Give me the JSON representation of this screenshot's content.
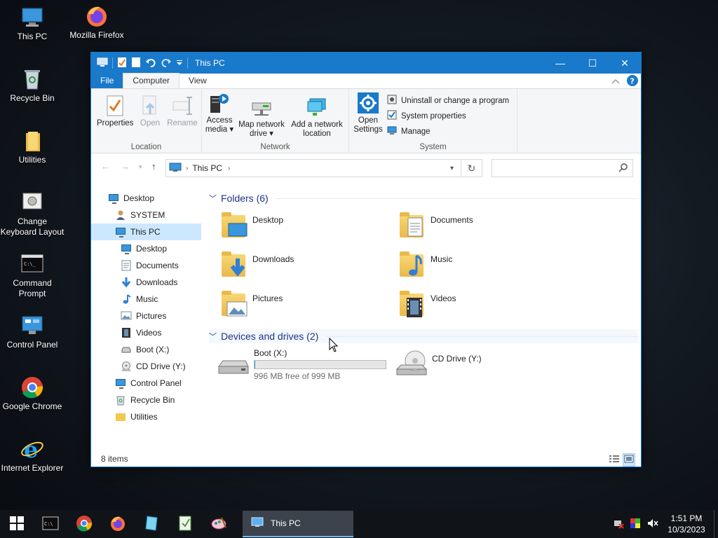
{
  "desktop": {
    "icons": [
      {
        "label": "This PC"
      },
      {
        "label": "Mozilla Firefox"
      },
      {
        "label": "Recycle Bin"
      },
      {
        "label": "Utilities"
      },
      {
        "label": "Change Keyboard Layout"
      },
      {
        "label": "Command Prompt"
      },
      {
        "label": "Control Panel"
      },
      {
        "label": "Google Chrome"
      },
      {
        "label": "Internet Explorer"
      }
    ]
  },
  "window": {
    "title": "This PC",
    "controls": {
      "minimize": "—",
      "maximize": "☐",
      "close": "✕"
    },
    "tabs": [
      "File",
      "Computer",
      "View"
    ],
    "ribbon": {
      "location": {
        "label": "Location",
        "properties": "Properties",
        "open": "Open",
        "rename": "Rename"
      },
      "network": {
        "label": "Network",
        "access_media": "Access media",
        "map_drive": "Map network drive",
        "add_location": "Add a network location"
      },
      "system": {
        "label": "System",
        "open_settings": "Open Settings",
        "uninstall": "Uninstall or change a program",
        "system_properties": "System properties",
        "manage": "Manage"
      }
    },
    "address": {
      "path": "This PC",
      "search_placeholder": ""
    },
    "nav": [
      {
        "label": "Desktop"
      },
      {
        "label": "SYSTEM"
      },
      {
        "label": "This PC"
      },
      {
        "label": "Desktop"
      },
      {
        "label": "Documents"
      },
      {
        "label": "Downloads"
      },
      {
        "label": "Music"
      },
      {
        "label": "Pictures"
      },
      {
        "label": "Videos"
      },
      {
        "label": "Boot (X:)"
      },
      {
        "label": "CD Drive (Y:)"
      },
      {
        "label": "Control Panel"
      },
      {
        "label": "Recycle Bin"
      },
      {
        "label": "Utilities"
      }
    ],
    "folders_header": "Folders (6)",
    "folders": [
      {
        "name": "Desktop"
      },
      {
        "name": "Documents"
      },
      {
        "name": "Downloads"
      },
      {
        "name": "Music"
      },
      {
        "name": "Pictures"
      },
      {
        "name": "Videos"
      }
    ],
    "devices_header": "Devices and drives (2)",
    "devices": [
      {
        "name": "Boot (X:)",
        "free": "996 MB free of 999 MB",
        "used_fraction": 0.003
      },
      {
        "name": "CD Drive (Y:)"
      }
    ],
    "status": "8 items"
  },
  "taskbar": {
    "active_window": "This PC",
    "time": "1:51 PM",
    "date": "10/3/2023"
  },
  "colors": {
    "accent": "#1979ca",
    "selection": "#cce8ff",
    "group_header": "#1e3287"
  }
}
